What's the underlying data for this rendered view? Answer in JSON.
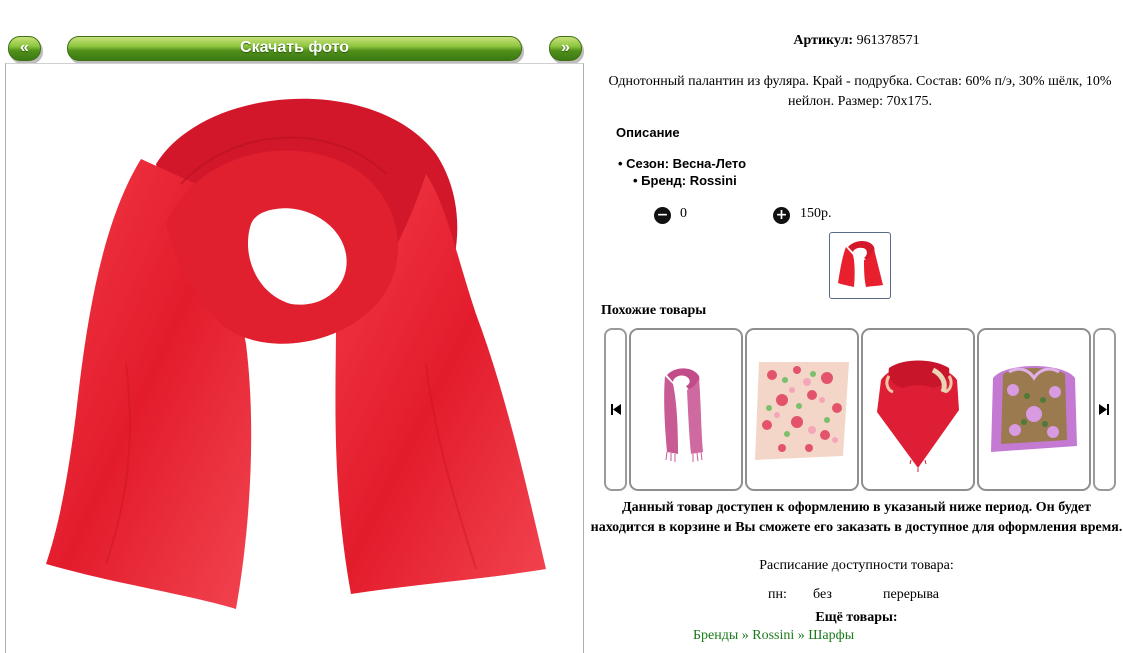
{
  "nav": {
    "prev_label": "«",
    "download_label": "Скачать фото",
    "next_label": "»"
  },
  "product": {
    "article_label": "Артикул:",
    "article_value": "961378571",
    "description": "Однотонный палантин из фуляра. Край - подрубка. Состав: 60% п/э, 30% шёлк, 10% нейлон. Размер: 70х175.",
    "opis_heading": "Описание",
    "opis_items": [
      "• Сезон: Весна-Лето",
      "• Бренд: Rossini"
    ],
    "qty_value": "0",
    "price": "150р.",
    "main_color": "#e8202e"
  },
  "similar": {
    "title": "Похожие товары",
    "items": [
      {
        "name": "pink-scarf"
      },
      {
        "name": "floral-scarf"
      },
      {
        "name": "red-shawl"
      },
      {
        "name": "lilac-paisley-shawl"
      }
    ]
  },
  "notice": "Данный товар доступен к оформлению в указаный ниже период. Он будет находится в корзине и Вы сможете его заказать в доступное для оформления время.",
  "schedule": {
    "title": "Расписание доступности товара:",
    "day": "пн:",
    "from": "без",
    "to": "перерыва"
  },
  "more": {
    "title": "Ещё товары:",
    "link": "Бренды » Rossini » Шарфы"
  }
}
